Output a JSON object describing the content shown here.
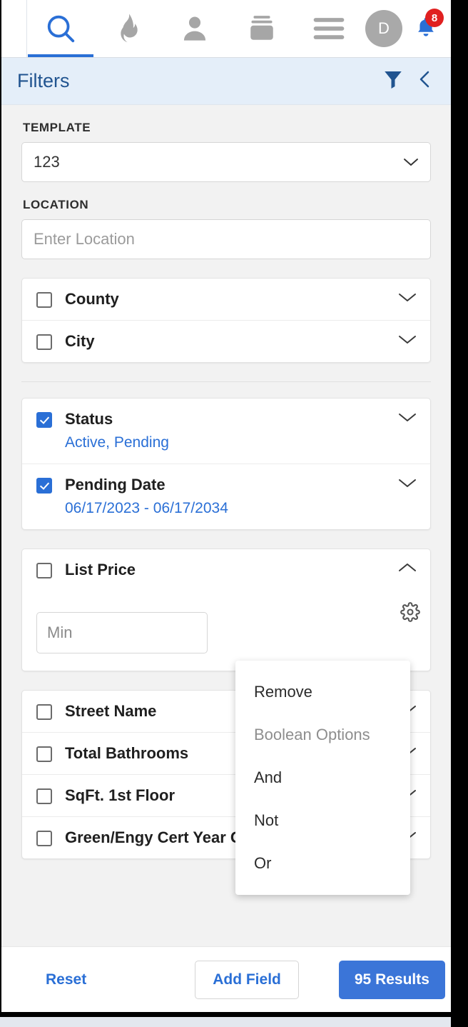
{
  "topnav": {
    "items": [
      {
        "name": "search-icon",
        "label": "Search",
        "active": true
      },
      {
        "name": "flame-icon",
        "label": "Hotsheet",
        "active": false
      },
      {
        "name": "person-icon",
        "label": "Contacts",
        "active": false
      },
      {
        "name": "cards-icon",
        "label": "Listings",
        "active": false
      },
      {
        "name": "hamburger-menu-icon",
        "label": "Menu",
        "active": false
      }
    ],
    "avatar_initial": "D",
    "notification_count": "8"
  },
  "filters_header": {
    "title": "Filters",
    "funnel_icon": "funnel-icon",
    "collapse_icon": "chevron-left-icon"
  },
  "template": {
    "label": "TEMPLATE",
    "value": "123"
  },
  "location": {
    "label": "LOCATION",
    "placeholder": "Enter Location"
  },
  "group_location": [
    {
      "title": "County",
      "checked": false,
      "sub": ""
    },
    {
      "title": "City",
      "checked": false,
      "sub": ""
    }
  ],
  "group_status": [
    {
      "title": "Status",
      "checked": true,
      "sub": "Active, Pending"
    },
    {
      "title": "Pending Date",
      "checked": true,
      "sub": "06/17/2023 - 06/17/2034"
    }
  ],
  "list_price": {
    "title": "List Price",
    "checked": false,
    "min_placeholder": "Min",
    "gear_icon": "gear-icon",
    "expanded": true
  },
  "group_fields": [
    {
      "title": "Street Name",
      "checked": false
    },
    {
      "title": "Total Bathrooms",
      "checked": false
    },
    {
      "title": "SqFt. 1st Floor",
      "checked": false
    },
    {
      "title": "Green/Engy Cert Year Green/Engy Cert Y...",
      "checked": false
    }
  ],
  "context_menu": {
    "items": [
      {
        "label": "Remove",
        "disabled": false
      },
      {
        "label": "Boolean Options",
        "disabled": true
      },
      {
        "label": "And",
        "disabled": false
      },
      {
        "label": "Not",
        "disabled": false
      },
      {
        "label": "Or",
        "disabled": false
      }
    ]
  },
  "bottom_bar": {
    "reset": "Reset",
    "add_field": "Add Field",
    "results": "95 Results"
  },
  "colors": {
    "accent_blue": "#2a6fd6",
    "header_blue_text": "#215490",
    "header_blue_bg": "#e4eef9",
    "results_button": "#3b75d8",
    "badge_red": "#e02020"
  }
}
